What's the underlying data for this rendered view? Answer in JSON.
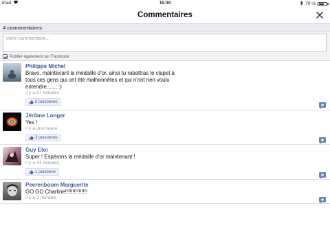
{
  "status_bar": {
    "carrier": "iPad",
    "time": "15:39",
    "battery_text": "70 %",
    "battery_level": 0.7
  },
  "header": {
    "title": "Commentaires",
    "close_icon": "close-icon"
  },
  "comment_count": "4 commentaires",
  "composer": {
    "placeholder": "Votre commentaire...",
    "value": "",
    "facebook_checkbox_label": "Publier également sur Facebook",
    "facebook_checked": true
  },
  "comments": [
    {
      "author": "Philippe Michel",
      "text": "Bravo, maintenant la médaille d'or, ainsi tu rabattras le clapet à tous ces gens qui ont été malhonnêtes et qui n'ont rien voulu entendre......; :)",
      "time": "il y a 57 minutes",
      "likes": "6 personnes",
      "avatar_color": "#6f8a9c"
    },
    {
      "author": "Jérôme Longer",
      "text": "Yes !",
      "time": "il y a une heure",
      "likes": "3 personnes",
      "avatar_color": "#0c0c18"
    },
    {
      "author": "Guy Eloi",
      "text": "Super ! Espérons la médaille d'or maintenant !",
      "time": "il y a 41 minutes",
      "likes": "1 personne",
      "avatar_color": "#7a3a58"
    },
    {
      "author": "Peerenboom Marguerite",
      "text": "GO GO Charline!!!!!!!!!!!!!!!",
      "time": "il y a 2 minutes",
      "likes": null,
      "avatar_color": "#5a5a5a"
    }
  ],
  "colors": {
    "link_blue": "#3b5998",
    "reply_icon": "#6d84b4"
  }
}
